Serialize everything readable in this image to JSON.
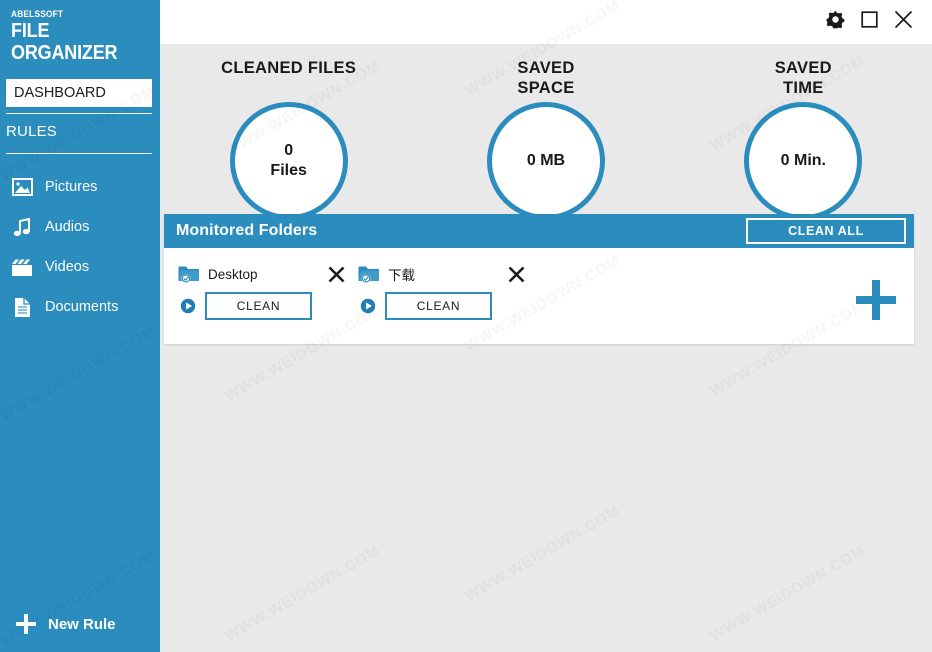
{
  "app": {
    "brand_top": "ABELSSOFT",
    "brand_main": "FILE ORGANIZER",
    "accent_color": "#2b8cbe",
    "background_color": "#e9e9e9"
  },
  "titlebar": {
    "settings_icon": "gear-icon",
    "maximize_icon": "maximize-square-icon",
    "close_icon": "close-x-icon"
  },
  "sidebar": {
    "dashboard_label": "DASHBOARD",
    "rules_label": "RULES",
    "items": [
      {
        "label": "Pictures",
        "icon": "picture-icon"
      },
      {
        "label": "Audios",
        "icon": "music-note-icon"
      },
      {
        "label": "Videos",
        "icon": "clapperboard-icon"
      },
      {
        "label": "Documents",
        "icon": "document-icon"
      }
    ],
    "new_rule_label": "New Rule",
    "new_rule_icon": "plus-icon"
  },
  "stats": [
    {
      "title": "CLEANED FILES",
      "value": "0",
      "unit": "Files",
      "stacked": true
    },
    {
      "title": "SAVED\nSPACE",
      "title_line1": "SAVED",
      "title_line2": "SPACE",
      "value": "0 MB",
      "stacked": false
    },
    {
      "title": "SAVED\nTIME",
      "title_line1": "SAVED",
      "title_line2": "TIME",
      "value": "0 Min.",
      "stacked": false
    }
  ],
  "monitored_folders": {
    "title": "Monitored Folders",
    "clean_all_label": "CLEAN ALL",
    "add_icon": "plus-icon",
    "folders": [
      {
        "name": "Desktop",
        "icon": "folder-checked-icon",
        "play_icon": "play-circle-icon",
        "remove_icon": "close-x-icon",
        "clean_label": "CLEAN"
      },
      {
        "name": "下载",
        "icon": "folder-checked-icon",
        "play_icon": "play-circle-icon",
        "remove_icon": "close-x-icon",
        "clean_label": "CLEAN"
      }
    ]
  },
  "watermarks": [
    "WWW.WEIDOWN.COM",
    "WWW.WEIDOWN.COM",
    "WWW.WEIDOWN.COM",
    "WWW.WEIDOWN.COM",
    "WWW.WEIDOWN.COM",
    "WWW.WEIDOWN.COM",
    "WWW.WEIDOWN.COM",
    "WWW.WEIDOWN.COM",
    "WWW.WEIDOWN.COM",
    "WWW.WEIDOWN.COM",
    "WWW.WEIDOWN.COM",
    "WWW.WEIDOWN.COM"
  ]
}
